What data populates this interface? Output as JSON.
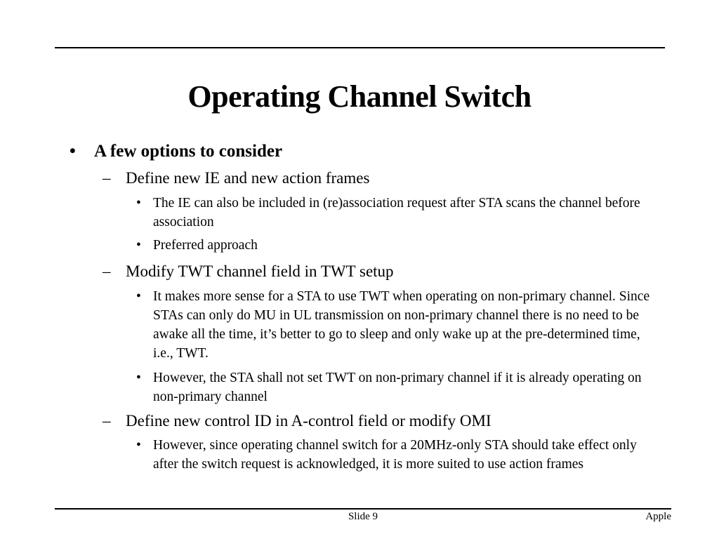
{
  "slide": {
    "title": "Operating Channel Switch",
    "bullets": [
      {
        "text": "A few options to consider",
        "symbol": "•",
        "children": [
          {
            "text": "Define new IE and new action frames",
            "symbol": "–",
            "children": [
              {
                "text": "The IE can also be included in (re)association request after STA scans the channel before association",
                "symbol": "•"
              },
              {
                "text": "Preferred approach",
                "symbol": "•"
              }
            ]
          },
          {
            "text": "Modify  TWT channel field in TWT setup",
            "symbol": "–",
            "children": [
              {
                "text": "It makes more sense for a STA to use TWT when operating on non-primary channel. Since STAs can only do MU in UL transmission on non-primary channel there is no need to be awake all the time, it’s better to go to sleep and only wake up at the pre-determined time, i.e., TWT.",
                "symbol": "•"
              },
              {
                "text": "However, the STA shall not set TWT on non-primary channel if it is already operating on non-primary channel",
                "symbol": "•"
              }
            ]
          },
          {
            "text": "Define new control ID in A-control field or modify OMI",
            "symbol": "–",
            "children": [
              {
                "text": "However, since operating channel switch for a 20MHz-only STA should take effect only after the switch request is acknowledged, it is more suited to use action frames",
                "symbol": "•"
              }
            ]
          }
        ]
      }
    ]
  },
  "footer": {
    "slide_label": "Slide 9",
    "organization": "Apple"
  }
}
